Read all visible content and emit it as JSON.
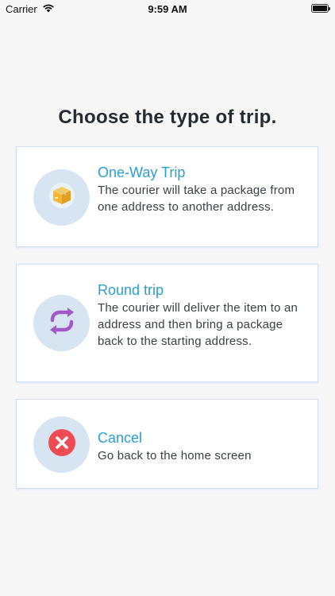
{
  "status_bar": {
    "carrier": "Carrier",
    "time": "9:59 AM"
  },
  "page": {
    "title": "Choose the type of trip."
  },
  "options": [
    {
      "title": "One-Way Trip",
      "description": "The courier will take a package from one address to another address.",
      "icon": "package-icon"
    },
    {
      "title": "Round trip",
      "description": "The courier will deliver the item to an address and then bring a package back to the starting address.",
      "icon": "round-trip-arrows-icon"
    },
    {
      "title": "Cancel",
      "description": "Go back to the home screen",
      "icon": "cancel-x-icon"
    }
  ],
  "colors": {
    "accent": "#2a9fd1",
    "icon_bg": "#d7e5f3",
    "card_border": "#cfe0f2",
    "round_trip_icon": "#a25ac8",
    "cancel_icon": "#ef4b52",
    "package_icon": "#f2b833"
  }
}
